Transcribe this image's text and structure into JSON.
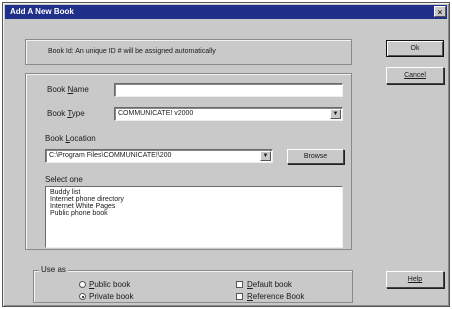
{
  "window": {
    "title": "Add A New Book",
    "close_glyph": "×"
  },
  "info": {
    "text": "Book Id: An unique ID # will be assigned automatically"
  },
  "form": {
    "name_label_pre": "Book ",
    "name_label_u": "N",
    "name_label_post": "ame",
    "name_value": "",
    "type_label_pre": "Book ",
    "type_label_u": "T",
    "type_label_post": "ype",
    "type_value": "COMMUNICATE! v2000",
    "location_label_pre": "Book ",
    "location_label_u": "L",
    "location_label_post": "ocation",
    "location_value": "C:\\Program Files\\COMMUNICATE!\\200",
    "browse_label": "Browse",
    "select_label": "Select one"
  },
  "list_items": [
    "Buddy list",
    "Internet phone directory",
    "Internet White Pages",
    "Public phone book"
  ],
  "use_as": {
    "legend": "Use as",
    "public_label_u": "P",
    "public_label_post": "ublic book",
    "private_label": "Private book",
    "private_selected": true,
    "default_label_u": "D",
    "default_label_post": "efault book",
    "reference_label_u": "R",
    "reference_label_post": "eference Book"
  },
  "buttons": {
    "ok": "Ok",
    "cancel": "Cancel",
    "help": "Help"
  }
}
